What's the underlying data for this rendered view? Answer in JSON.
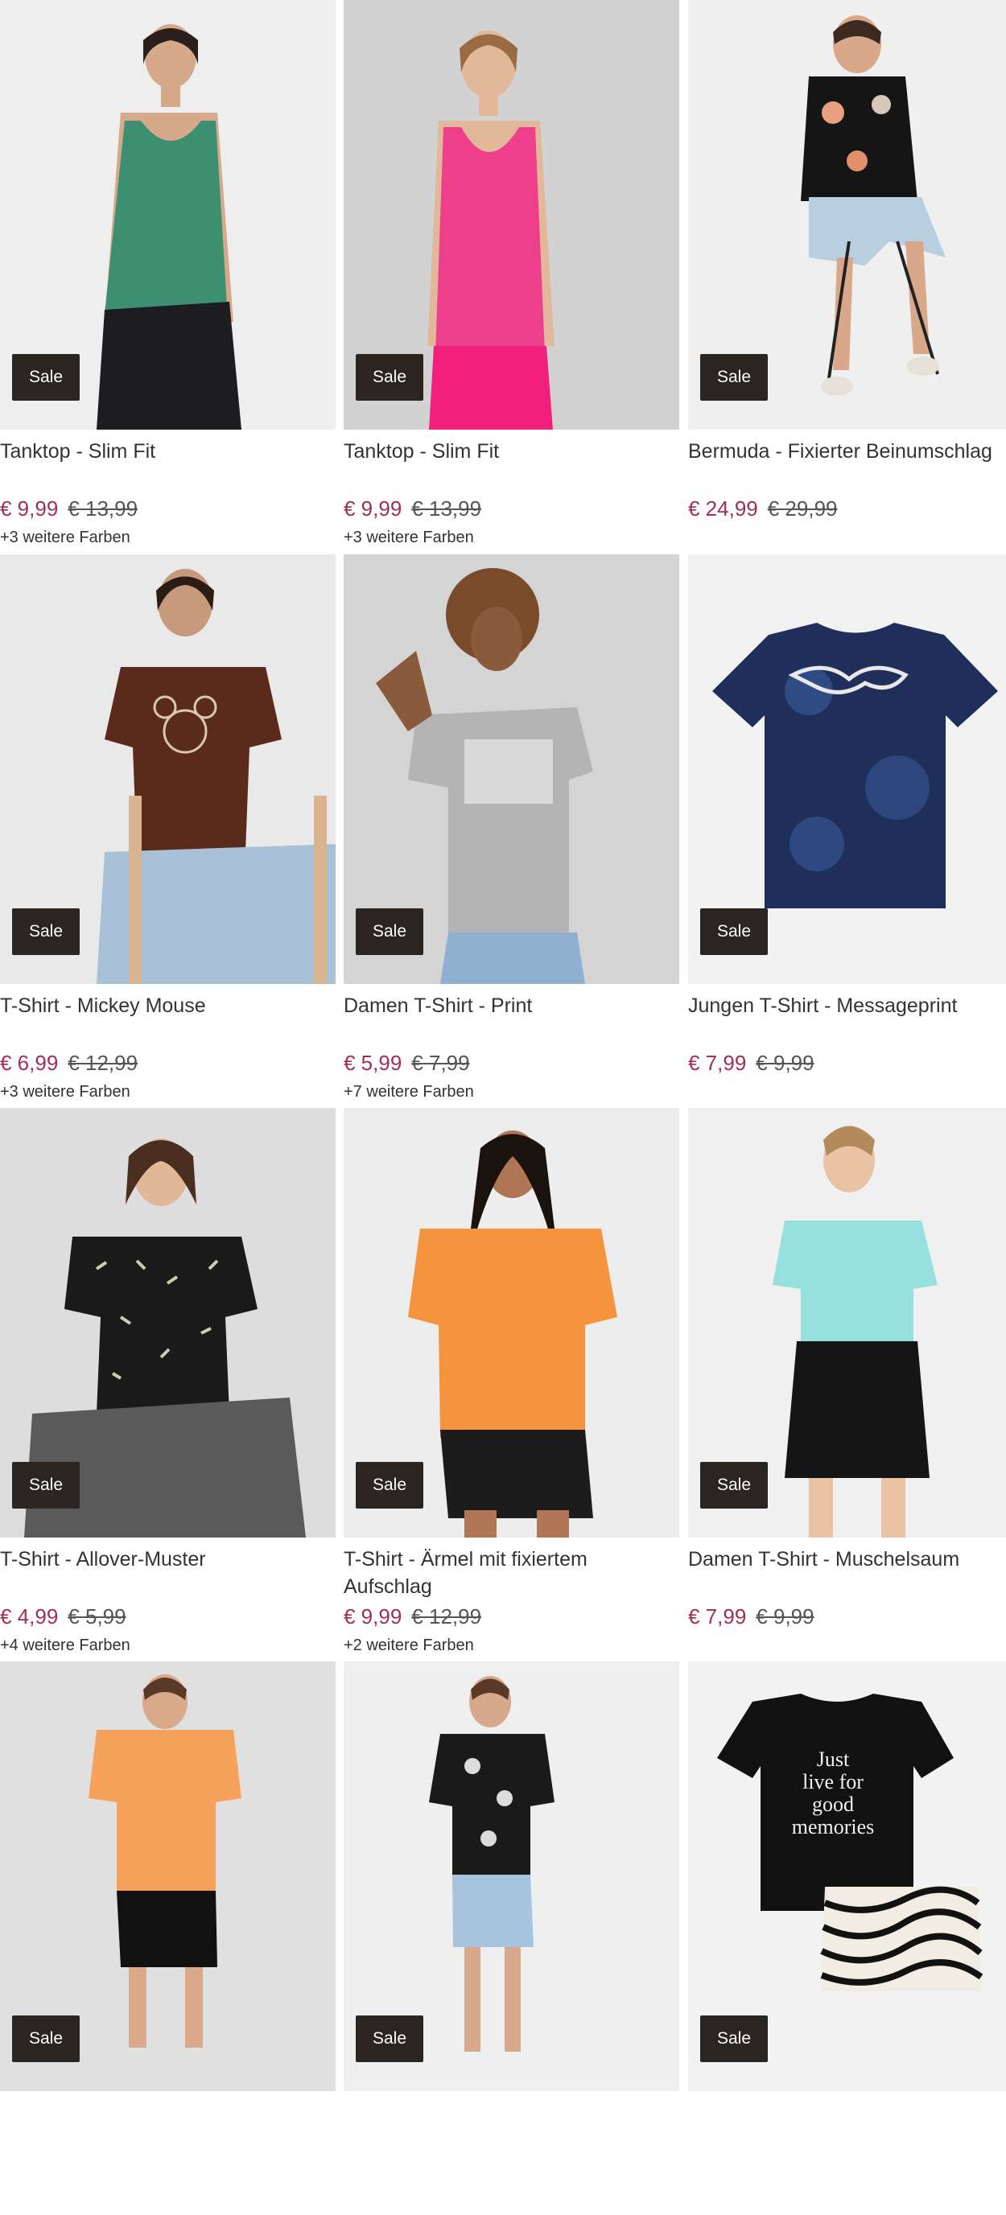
{
  "colors": {
    "sale_price": "#a22f57",
    "badge_bg": "#2b2522",
    "badge_text": "#ffffff"
  },
  "products": [
    {
      "title": "Tanktop - Slim Fit",
      "badge": "Sale",
      "price": "€ 9,99",
      "old_price": "€ 13,99",
      "more_colors": "+3 weitere Farben",
      "image": "woman-green-tanktop"
    },
    {
      "title": "Tanktop - Slim Fit",
      "badge": "Sale",
      "price": "€ 9,99",
      "old_price": "€ 13,99",
      "more_colors": "+3 weitere Farben",
      "image": "woman-pink-tanktop"
    },
    {
      "title": "Bermuda - Fixierter Beinumschlag",
      "badge": "Sale",
      "price": "€ 24,99",
      "old_price": "€ 29,99",
      "more_colors": "",
      "image": "man-floral-shirt-bermuda"
    },
    {
      "title": "T-Shirt - Mickey Mouse",
      "badge": "Sale",
      "price": "€ 6,99",
      "old_price": "€ 12,99",
      "more_colors": "+3 weitere Farben",
      "image": "woman-brown-mickey-tshirt"
    },
    {
      "title": "Damen T-Shirt - Print",
      "badge": "Sale",
      "price": "€ 5,99",
      "old_price": "€ 7,99",
      "more_colors": "+7 weitere Farben",
      "image": "woman-grey-print-tshirt"
    },
    {
      "title": "Jungen T-Shirt - Messageprint",
      "badge": "Sale",
      "price": "€ 7,99",
      "old_price": "€ 9,99",
      "more_colors": "",
      "image": "navy-tie-dye-tshirt"
    },
    {
      "title": "T-Shirt - Allover-Muster",
      "badge": "Sale",
      "price": "€ 4,99",
      "old_price": "€ 5,99",
      "more_colors": "+4 weitere Farben",
      "image": "woman-black-pattern-tshirt"
    },
    {
      "title": "T-Shirt - Ärmel mit fixiertem Aufschlag",
      "badge": "Sale",
      "price": "€ 9,99",
      "old_price": "€ 12,99",
      "more_colors": "+2 weitere Farben",
      "image": "woman-orange-tshirt"
    },
    {
      "title": "Damen T-Shirt - Muschelsaum",
      "badge": "Sale",
      "price": "€ 7,99",
      "old_price": "€ 9,99",
      "more_colors": "",
      "image": "woman-mint-tshirt"
    },
    {
      "title": "",
      "badge": "Sale",
      "price": "",
      "old_price": "",
      "more_colors": "",
      "image": "man-orange-chapter-tshirt"
    },
    {
      "title": "",
      "badge": "Sale",
      "price": "",
      "old_price": "",
      "more_colors": "",
      "image": "man-bandana-shirt"
    },
    {
      "title": "",
      "badge": "Sale",
      "price": "",
      "old_price": "",
      "more_colors": "",
      "image": "black-tshirt-zebra-shorts-set"
    }
  ]
}
